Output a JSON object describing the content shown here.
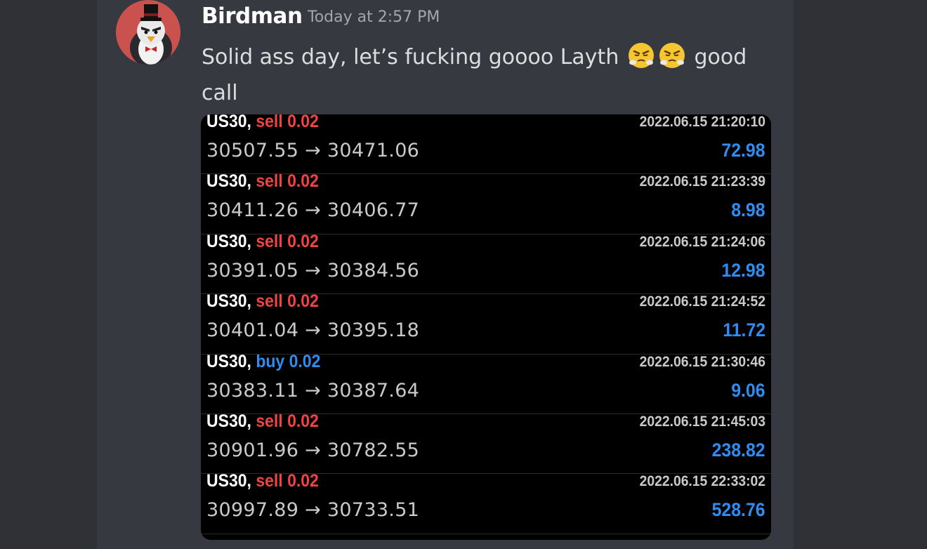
{
  "message": {
    "author": "Birdman",
    "timestamp": "Today at 2:57 PM",
    "text_part1": "Solid ass day, let’s fucking goooo Layth",
    "emoji": [
      "huffing-face-emoji",
      "huffing-face-emoji"
    ],
    "text_part2": "good call"
  },
  "trades": [
    {
      "symbol": "US30,",
      "side": "sell",
      "volume": "sell 0.02",
      "prices": "30507.55 → 30471.06",
      "time": "2022.06.15 21:20:10",
      "profit": "72.98"
    },
    {
      "symbol": "US30,",
      "side": "sell",
      "volume": "sell 0.02",
      "prices": "30411.26 → 30406.77",
      "time": "2022.06.15 21:23:39",
      "profit": "8.98"
    },
    {
      "symbol": "US30,",
      "side": "sell",
      "volume": "sell 0.02",
      "prices": "30391.05 → 30384.56",
      "time": "2022.06.15 21:24:06",
      "profit": "12.98"
    },
    {
      "symbol": "US30,",
      "side": "sell",
      "volume": "sell 0.02",
      "prices": "30401.04 → 30395.18",
      "time": "2022.06.15 21:24:52",
      "profit": "11.72"
    },
    {
      "symbol": "US30,",
      "side": "buy",
      "volume": "buy 0.02",
      "prices": "30383.11 → 30387.64",
      "time": "2022.06.15 21:30:46",
      "profit": "9.06"
    },
    {
      "symbol": "US30,",
      "side": "sell",
      "volume": "sell 0.02",
      "prices": "30901.96 → 30782.55",
      "time": "2022.06.15 21:45:03",
      "profit": "238.82"
    },
    {
      "symbol": "US30,",
      "side": "sell",
      "volume": "sell 0.02",
      "prices": "30997.89 → 30733.51",
      "time": "2022.06.15 22:33:02",
      "profit": "528.76"
    }
  ],
  "colors": {
    "sell": "#ef4443",
    "buy": "#2f8cf0",
    "profit": "#2f8cf0",
    "avatar_bg": "#c9524e"
  }
}
